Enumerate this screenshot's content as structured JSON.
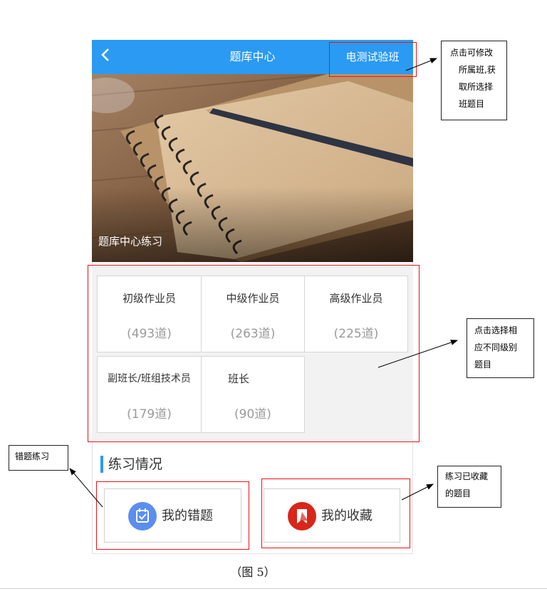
{
  "header": {
    "back_icon": "chevron-left-icon",
    "title": "题库中心",
    "class_name": "电测试验班"
  },
  "hero": {
    "caption": "题库中心练习"
  },
  "levels": [
    {
      "name": "初级作业员",
      "count": "(493道)"
    },
    {
      "name": "中级作业员",
      "count": "(263道)"
    },
    {
      "name": "高级作业员",
      "count": "(225道)"
    },
    {
      "name": "副班长/班组技术员",
      "count": "(179道)"
    },
    {
      "name": "班长",
      "count": "(90道)"
    }
  ],
  "practice": {
    "section_title": "练习情况",
    "wrong_label": "我的错题",
    "wrong_icon": "calendar-check-icon",
    "fav_label": "我的收藏",
    "fav_icon": "bookmark-icon"
  },
  "annotations": {
    "class_note": [
      "点击可修改",
      "所属班,获",
      "取所选择",
      "班题目"
    ],
    "level_note": [
      "点击选择相",
      "应不同级别",
      "题目"
    ],
    "wrong_note": "错题练习",
    "fav_note": [
      "练习已收藏",
      "的题目"
    ]
  },
  "figure_caption": "（图 5）",
  "colors": {
    "primary": "#2b9af3",
    "highlight": "#e8131b",
    "wrong_icon_bg": "#5b8ef0",
    "fav_icon_bg": "#d8261a"
  }
}
